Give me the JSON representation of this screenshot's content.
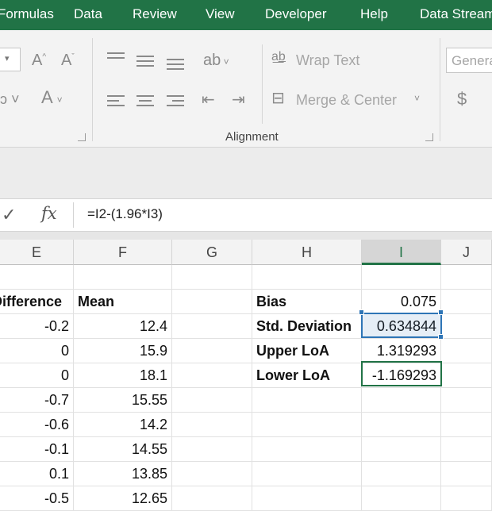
{
  "menu": [
    "Formulas",
    "Data",
    "Review",
    "View",
    "Developer",
    "Help",
    "Data Streamer"
  ],
  "ribbon": {
    "wrap_text": "Wrap Text",
    "merge_center": "Merge & Center",
    "alignment_label": "Alignment",
    "number_format": "General",
    "currency": "$",
    "icon_names": [
      "font-grow-icon",
      "font-shrink-icon",
      "font-color-icon",
      "align-top-icon",
      "align-middle-icon",
      "align-bottom-icon",
      "orientation-icon",
      "align-left-icon",
      "center-icon",
      "align-right-icon",
      "decrease-indent-icon",
      "increase-indent-icon",
      "wrap-text-icon",
      "merge-center-icon"
    ]
  },
  "formula_bar": {
    "check": "✓",
    "fx": "fx",
    "content": "=I2-(1.96*I3)"
  },
  "columns": [
    "E",
    "F",
    "G",
    "H",
    "I",
    "J"
  ],
  "active_column": "I",
  "sheet": {
    "header": {
      "E": "Difference",
      "F": "Mean",
      "H": "Bias",
      "I": "0.075"
    },
    "rows": [
      {
        "E": "-0.2",
        "F": "12.4",
        "H": "Std. Deviation",
        "I": "0.634844"
      },
      {
        "E": "0",
        "F": "15.9",
        "H": "Upper LoA",
        "I": "1.319293"
      },
      {
        "E": "0",
        "F": "18.1",
        "H": "Lower LoA",
        "I": "-1.169293"
      },
      {
        "E": "-0.7",
        "F": "15.55"
      },
      {
        "E": "-0.6",
        "F": "14.2"
      },
      {
        "E": "-0.1",
        "F": "14.55"
      },
      {
        "E": "0.1",
        "F": "13.85"
      },
      {
        "E": "-0.5",
        "F": "12.65"
      }
    ]
  },
  "colors": {
    "excel_green": "#217346",
    "selection_blue": "#2e75b6"
  }
}
